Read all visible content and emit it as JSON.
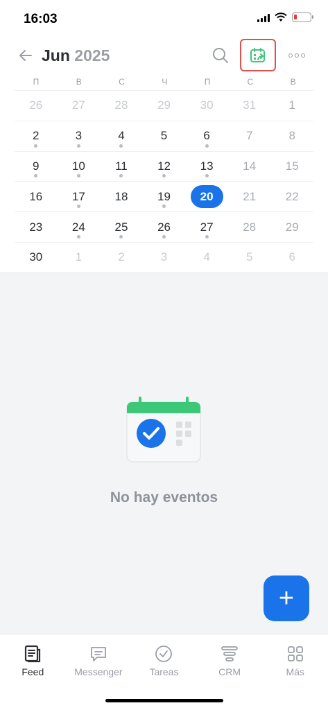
{
  "status": {
    "time": "16:03"
  },
  "header": {
    "month": "Jun",
    "year": "2025"
  },
  "weekdays": [
    "П",
    "В",
    "С",
    "Ч",
    "П",
    "С",
    "В"
  ],
  "weeks": [
    [
      "26",
      "27",
      "28",
      "29",
      "30",
      "31",
      "1"
    ],
    [
      "2",
      "3",
      "4",
      "5",
      "6",
      "7",
      "8"
    ],
    [
      "9",
      "10",
      "11",
      "12",
      "13",
      "14",
      "15"
    ],
    [
      "16",
      "17",
      "18",
      "19",
      "20",
      "21",
      "22"
    ],
    [
      "23",
      "24",
      "25",
      "26",
      "27",
      "28",
      "29"
    ],
    [
      "30",
      "1",
      "2",
      "3",
      "4",
      "5",
      "6"
    ]
  ],
  "today": "20",
  "empty": {
    "message": "No hay eventos"
  },
  "fab": {
    "symbol": "+"
  },
  "tabs": [
    {
      "label": "Feed",
      "icon": "feed-icon"
    },
    {
      "label": "Messenger",
      "icon": "messenger-icon"
    },
    {
      "label": "Tareas",
      "icon": "tasks-icon"
    },
    {
      "label": "CRM",
      "icon": "crm-icon"
    },
    {
      "label": "Más",
      "icon": "more-grid-icon"
    }
  ],
  "colors": {
    "accent": "#1a73e8",
    "green": "#3cc878",
    "highlight": "#d9534f"
  }
}
